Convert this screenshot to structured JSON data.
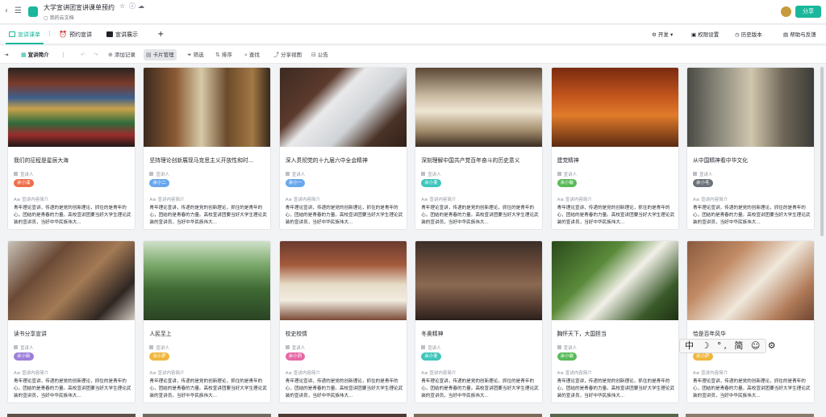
{
  "app": {
    "title": "大学宣讲团宣讲课单预约",
    "subtitle": "我的云文档",
    "share_label": "分享",
    "accent": "#1ab79c"
  },
  "tabs": [
    {
      "label": "宣讲课单",
      "active": true
    },
    {
      "label": "预约宣讲",
      "active": false
    },
    {
      "label": "宣讲展示",
      "active": false
    }
  ],
  "right_menu": {
    "dev": "开发",
    "perm": "权限设置",
    "history": "历史版本",
    "help": "帮助与反馈"
  },
  "toolbar": {
    "view": "宣讲简介",
    "add": "添加记录",
    "card": "卡片管理",
    "filter": "筛选",
    "sort": "排序",
    "find": "查找",
    "share_view": "分享视图",
    "notice": "公告"
  },
  "field_labels": {
    "speaker": "宣讲人",
    "content": "宣讲内容简介"
  },
  "cards": [
    {
      "title": "我们的征程是星辰大海",
      "tag": "余小溪",
      "tag_color": "#ee6f4b",
      "desc": "青年理论宣讲，传递的是党的创新理论，抓住的是青年的心，团结的是青春的力量。高校宣讲团要当好大学生理论武装的宣讲员，当好中华民族伟大..."
    },
    {
      "title": "坚持理论创新展现马克思主义开放性和时...",
      "tag": "余小二",
      "tag_color": "#68a7ec",
      "desc": "青年理论宣讲，传递的是党的创新理论，抓住的是青年的心，团结的是青春的力量。高校宣讲团要当好大学生理论武装的宣讲员，当好中华民族伟大..."
    },
    {
      "title": "深入贯彻党的十九届六中全会精神",
      "tag": "余小一",
      "tag_color": "#68a7ec",
      "desc": "青年理论宣讲，传递的是党的创新理论，抓住的是青年的心，团结的是青春的力量。高校宣讲团要当好大学生理论武装的宣讲员，当好中华民族伟大..."
    },
    {
      "title": "深刻理解中国共产党百年奋斗的历史意义",
      "tag": "余小麦",
      "tag_color": "#3fc5bb",
      "desc": "青年理论宣讲，传递的是党的创新理论，抓住的是青年的心，团结的是青春的力量。高校宣讲团要当好大学生理论武装的宣讲员，当好中华民族伟大..."
    },
    {
      "title": "建党精神",
      "tag": "余小敏",
      "tag_color": "#57ba57",
      "desc": "青年理论宣讲，传递的是党的创新理论，抓住的是青年的心，团结的是青春的力量。高校宣讲团要当好大学生理论武装的宣讲员，当好中华民族伟大..."
    },
    {
      "title": "从中国精神看中华文化",
      "tag": "余小毛",
      "tag_color": "#6d7278",
      "desc": "青年理论宣讲，传递的是党的创新理论，抓住的是青年的心，团结的是青春的力量。高校宣讲团要当好大学生理论武装的宣讲员，当好中华民族伟大..."
    },
    {
      "title": "读书分享宣讲",
      "tag": "余小新",
      "tag_color": "#9c7ed9",
      "desc": "青年理论宣讲，传递的是党的创新理论，抓住的是青年的心，团结的是青春的力量。高校宣讲团要当好大学生理论武装的宣讲员，当好中华民族伟大..."
    },
    {
      "title": "人民至上",
      "tag": "余小萨",
      "tag_color": "#f0b53c",
      "desc": "青年理论宣讲，传递的是党的创新理论，抓住的是青年的心，团结的是青春的力量。高校宣讲团要当好大学生理论武装的宣讲员，当好中华民族伟大..."
    },
    {
      "title": "校史校情",
      "tag": "余小莉",
      "tag_color": "#e667a6",
      "desc": "青年理论宣讲，传递的是党的创新理论，抓住的是青年的心，团结的是青春的力量。高校宣讲团要当好大学生理论武装的宣讲员，当好中华民族伟大..."
    },
    {
      "title": "冬奥精神",
      "tag": "余小麦",
      "tag_color": "#3fc5bb",
      "desc": "青年理论宣讲，传递的是党的创新理论，抓住的是青年的心，团结的是青春的力量。高校宣讲团要当好大学生理论武装的宣讲员，当好中华民族伟大..."
    },
    {
      "title": "胸怀天下，大国担当",
      "tag": "余小敏",
      "tag_color": "#57ba57",
      "desc": "青年理论宣讲，传递的是党的创新理论，抓住的是青年的心，团结的是青春的力量。高校宣讲团要当好大学生理论武装的宣讲员，当好中华民族伟大..."
    },
    {
      "title": "恰是百年风华",
      "tag": "余小萨",
      "tag_color": "#f0b53c",
      "desc": "青年理论宣讲，传递的是党的创新理论，抓住的是青年的心，团结的是青春的力量。高校宣讲团要当好大学生理论武装的宣讲员，当好中华民族伟大..."
    }
  ],
  "ime_bar": "中 ☽ °, 简 ☺ ⚙"
}
